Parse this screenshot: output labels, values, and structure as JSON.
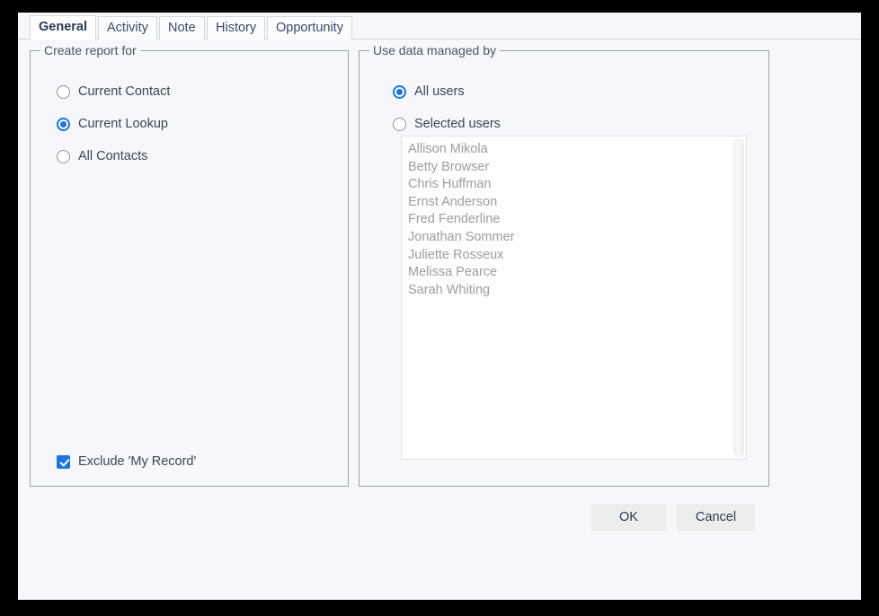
{
  "window": {
    "background_color": "#f5f7fa",
    "accent_color": "#1a73e8"
  },
  "tabs": [
    {
      "label": "General",
      "active": true
    },
    {
      "label": "Activity",
      "active": false
    },
    {
      "label": "Note",
      "active": false
    },
    {
      "label": "History",
      "active": false
    },
    {
      "label": "Opportunity",
      "active": false
    }
  ],
  "left_group": {
    "legend": "Create report for",
    "options": [
      {
        "label": "Current Contact",
        "selected": false
      },
      {
        "label": "Current Lookup",
        "selected": true
      },
      {
        "label": "All Contacts",
        "selected": false
      }
    ],
    "exclude_checkbox": {
      "label": "Exclude 'My Record'",
      "checked": true
    }
  },
  "right_group": {
    "legend": "Use data managed by",
    "options": [
      {
        "label": "All users",
        "selected": true
      },
      {
        "label": "Selected users",
        "selected": false
      }
    ],
    "user_list": [
      "Allison Mikola",
      "Betty Browser",
      "Chris Huffman",
      "Ernst Anderson",
      "Fred Fenderline",
      "Jonathan Sommer",
      "Juliette Rosseux",
      "Melissa Pearce",
      "Sarah Whiting"
    ]
  },
  "footer": {
    "ok_label": "OK",
    "cancel_label": "Cancel"
  }
}
